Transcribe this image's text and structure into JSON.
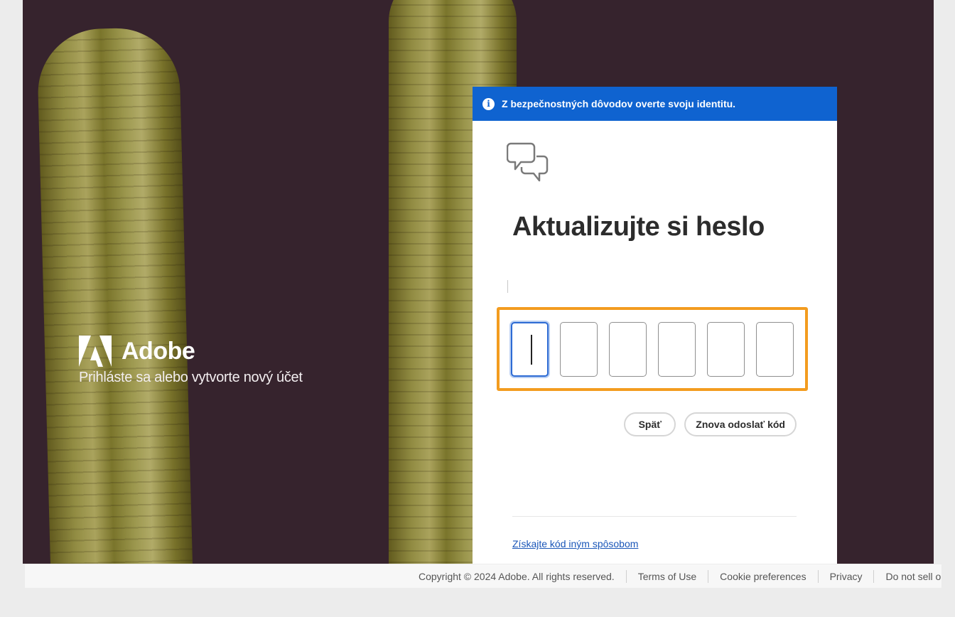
{
  "brand": {
    "name": "Adobe",
    "subtitle": "Prihláste sa alebo vytvorte nový účet"
  },
  "banner": {
    "text": "Z bezpečnostných dôvodov overte svoju identitu."
  },
  "card": {
    "title": "Aktualizujte si heslo",
    "code_digits": [
      "",
      "",
      "",
      "",
      "",
      ""
    ],
    "back_label": "Späť",
    "resend_label": "Znova odoslať kód",
    "alt_link": "Získajte kód iným spôsobom"
  },
  "footer": {
    "copyright": "Copyright © 2024 Adobe. All rights reserved.",
    "terms": "Terms of Use",
    "cookies": "Cookie preferences",
    "privacy": "Privacy",
    "do_not_sell": "Do not sell or share my personal information"
  },
  "colors": {
    "banner": "#0f63d0",
    "highlight": "#f39c1f",
    "background": "#3a2630"
  }
}
